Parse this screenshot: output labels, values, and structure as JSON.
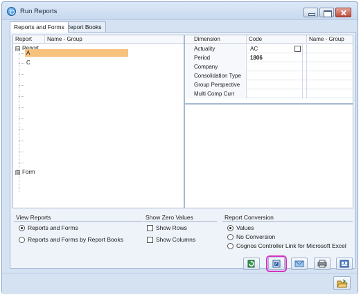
{
  "window": {
    "title": "Run Reports"
  },
  "tabs": [
    {
      "label": "Reports and Forms",
      "active": true
    },
    {
      "label": "Report Books",
      "active": false
    }
  ],
  "left_grid": {
    "columns": [
      "Report",
      "Name - Group"
    ],
    "tree": [
      {
        "label": "Report",
        "expander": "⊟",
        "children": [
          "A",
          "C"
        ]
      },
      {
        "label": "Form",
        "expander": "⊞"
      }
    ]
  },
  "right_grid": {
    "columns": [
      "Dimension",
      "Code",
      "Name - Group"
    ],
    "rows": [
      {
        "dimension": "Actuality",
        "code": "AC",
        "has_checkbox": true
      },
      {
        "dimension": "Period",
        "code": "1806"
      },
      {
        "dimension": "Company",
        "code": ""
      },
      {
        "dimension": "Consolidation Type",
        "code": ""
      },
      {
        "dimension": "Group Perspective",
        "code": ""
      },
      {
        "dimension": "Multi Comp Curr",
        "code": ""
      }
    ]
  },
  "view_reports": {
    "title": "View Reports",
    "options": [
      {
        "label": "Reports and Forms",
        "selected": true
      },
      {
        "label": "Reports and Forms by Report Books",
        "selected": false
      }
    ]
  },
  "show_zero_values": {
    "title": "Show Zero Values",
    "options": [
      {
        "label": "Show Rows",
        "checked": false
      },
      {
        "label": "Show Columns",
        "checked": false
      }
    ]
  },
  "report_conversion": {
    "title": "Report Conversion",
    "options": [
      {
        "label": "Values",
        "selected": true
      },
      {
        "label": "No Conversion",
        "selected": false
      },
      {
        "label": "Cognos Controller Link for Microsoft Excel",
        "selected": false
      }
    ]
  },
  "toolbar": {
    "icons": [
      "refresh-icon",
      "preview-icon",
      "email-icon",
      "print-icon",
      "export-icon"
    ]
  },
  "colors": {
    "selection": "#f6c27d",
    "highlight_outline": "#d631c2",
    "window_bg": "#d5e2f2"
  }
}
